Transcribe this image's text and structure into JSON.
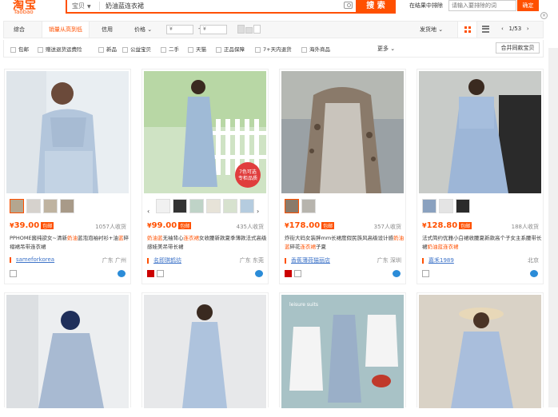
{
  "header": {
    "logo_cn": "淘宝",
    "logo_en": "Taobao",
    "category": "宝贝",
    "query": "奶油蓝连衣裙",
    "search_btn": "搜 索",
    "exclude_label": "在结果中排除",
    "exclude_placeholder": "请输入要排除的词",
    "exclude_btn": "确定"
  },
  "sort": {
    "items": [
      "综合",
      "销量从高到低",
      "信用",
      "价格"
    ],
    "price_from": "¥",
    "price_to": "¥",
    "dash": "-",
    "ship_from": "发货地",
    "page": "1/53"
  },
  "filters": [
    "包邮",
    "赠送退货运费险",
    "新品",
    "公益宝贝",
    "二手",
    "天猫",
    "正品保障",
    "7+天内退货",
    "海外商品"
  ],
  "more": "更多",
  "merge": "合并同款宝贝",
  "products": [
    {
      "price": "39.00",
      "badge": "包邮",
      "sold": "1057人收货",
      "title_pre": "PPHOME酱纯欲女~清新",
      "title_hl": "奶油",
      "title_mid": "蓝泡泡袖衬衫+油",
      "title_hl2": "蓝",
      "title_post": "碎褶裙吊带连衣裙",
      "shop": "sameforkorea",
      "loc": "广东 广州"
    },
    {
      "price": "99.00",
      "badge": "包邮",
      "sold": "435人收货",
      "title_pre": "",
      "title_hl": "奶油蓝",
      "title_mid": "无袖背心",
      "title_hl2": "连衣裙",
      "title_post": "女收腰新款夏季薄款法式高级感娃美吊带长裙",
      "shop": "名即琪鹤坊",
      "loc": "广东 东莞"
    },
    {
      "price": "178.00",
      "badge": "包邮",
      "sold": "357人收货",
      "title_pre": "炸街大码女装胖mm长裙度假民族风高级设计感",
      "title_hl": "奶油蓝",
      "title_mid": "碎花",
      "title_hl2": "连衣裙",
      "title_post": "子夏",
      "shop": "香蕉薄荷猫丽店",
      "loc": "广东 深圳"
    },
    {
      "price": "128.80",
      "badge": "包邮",
      "sold": "188人收货",
      "title_pre": "法式简约优雅小白裙收腰夏新款高个子女主系腰带长裙",
      "title_hl": "奶油蓝",
      "title_mid": "",
      "title_hl2": "连衣裙",
      "title_post": "",
      "shop": "嘉禾1989",
      "loc": "北京"
    }
  ],
  "badge_text": "7色可选 专柜品质",
  "img_caption": "leisure suits"
}
